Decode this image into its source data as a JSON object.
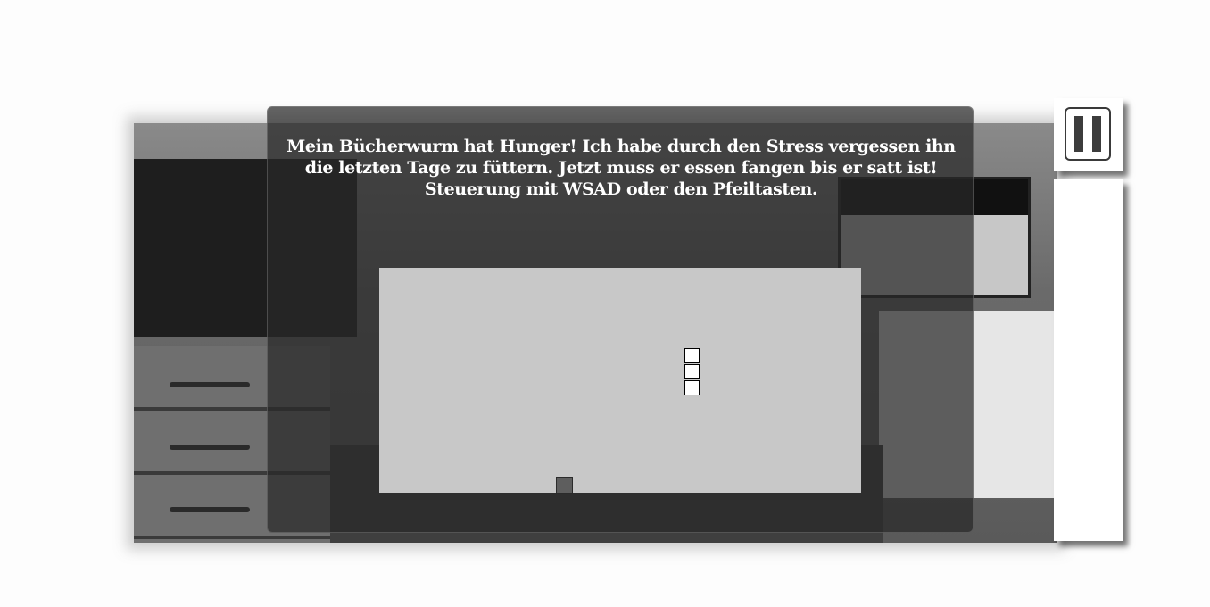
{
  "game": {
    "instructions": "Mein Bücherwurm hat Hunger! Ich habe durch den Stress vergessen ihn die letzten Tage zu füttern. Jetzt muss er essen fangen bis er satt ist! Steuerung mit WSAD oder den Pfeiltasten.",
    "worm_segment_count": 3,
    "food_count": 1
  },
  "controls": {
    "pause_icon": "pause-icon"
  },
  "colors": {
    "field": "#c8c8c8",
    "worm": "#ffffff",
    "food": "#5e5e5e",
    "overlay": "#282828"
  }
}
